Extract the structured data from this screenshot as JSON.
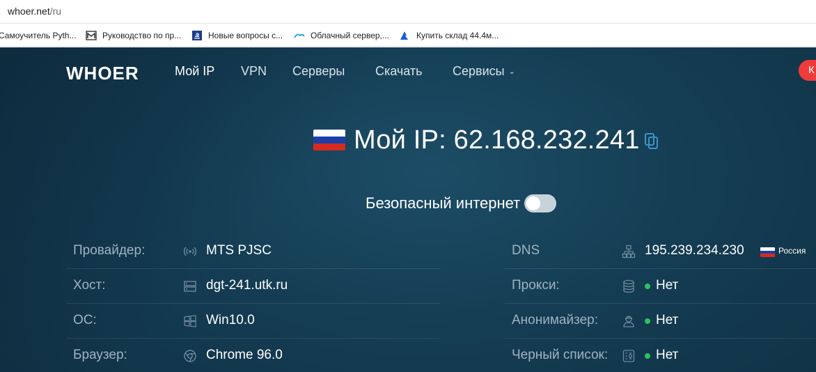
{
  "browser": {
    "url_host": "whoer.net",
    "url_path": "/ru",
    "bookmarks": [
      {
        "label": "Самоучитель Pyth...",
        "icon": "python-doc-icon"
      },
      {
        "label": "Руководство по пр...",
        "icon": "gmail-style-icon"
      },
      {
        "label": "Новые вопросы с...",
        "icon": "stackoverflow-icon"
      },
      {
        "label": "Облачный сервер,...",
        "icon": "cloud-icon"
      },
      {
        "label": "Купить склад 44.4м...",
        "icon": "arrow-logo-icon"
      }
    ]
  },
  "site": {
    "logo": "WHOER",
    "nav": [
      {
        "label": "Мой IP",
        "active": true
      },
      {
        "label": "VPN"
      },
      {
        "label": "Серверы"
      },
      {
        "label": "Скачать"
      },
      {
        "label": "Сервисы",
        "has_dropdown": true
      }
    ],
    "cta_label": "К",
    "ip_title": "Мой IP: 62.168.232.241",
    "safe_internet_label": "Безопасный интернет",
    "safe_internet_on": false,
    "left_rows": [
      {
        "label": "Провайдер:",
        "value": "MTS PJSC",
        "icon": "signal-icon"
      },
      {
        "label": "Хост:",
        "value": "dgt-241.utk.ru",
        "icon": "server-icon"
      },
      {
        "label": "ОС:",
        "value": "Win10.0",
        "icon": "windows-icon"
      },
      {
        "label": "Браузер:",
        "value": "Chrome 96.0",
        "icon": "chrome-icon"
      }
    ],
    "right_rows": [
      {
        "label": "DNS",
        "value": "195.239.234.230",
        "icon": "network-icon",
        "country": "Россия"
      },
      {
        "label": "Прокси:",
        "value": "Нет",
        "icon": "database-icon",
        "status": "ok"
      },
      {
        "label": "Анонимайзер:",
        "value": "Нет",
        "icon": "anonymous-icon",
        "status": "ok"
      },
      {
        "label": "Черный список:",
        "value": "Нет",
        "icon": "blacklist-icon",
        "status": "ok"
      }
    ],
    "colors": {
      "accent_red": "#ef3b3b",
      "status_green": "#2ec25f",
      "background": "#143c52"
    }
  }
}
